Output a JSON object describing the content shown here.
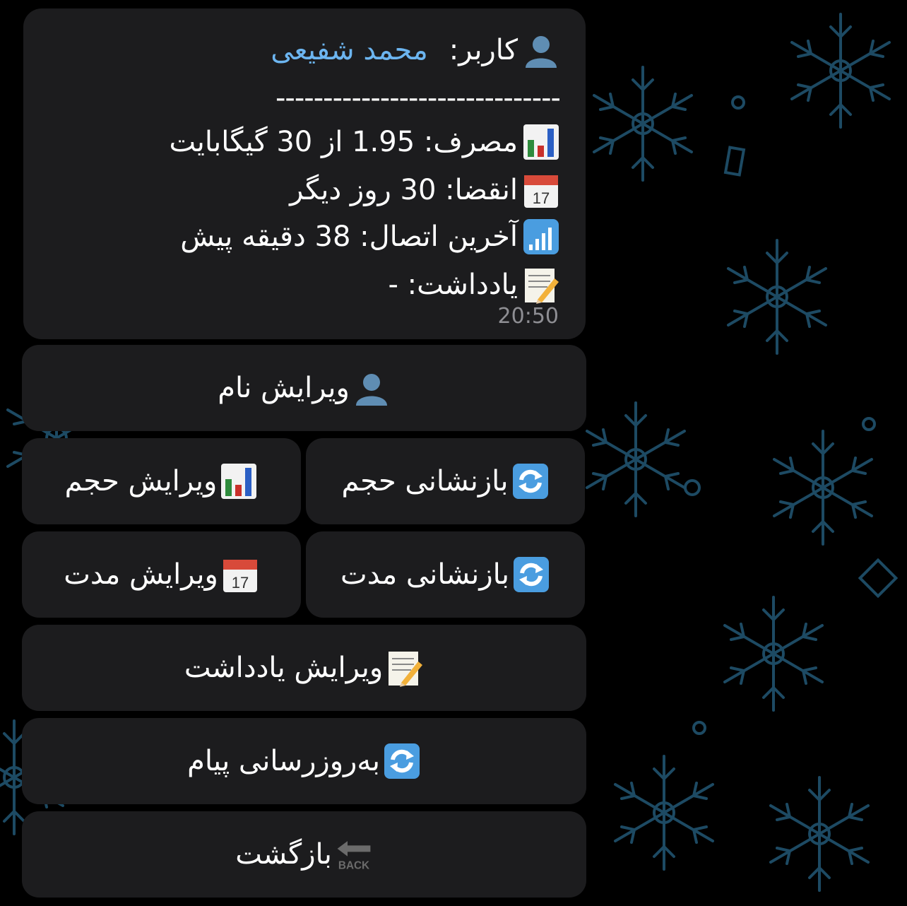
{
  "message": {
    "user_label": "کاربر:",
    "user_name": "محمد شفیعی",
    "separator": "------------------------------",
    "usage": "مصرف: 1.95 از 30 گیگابایت",
    "expiry": "انقضا: 30 روز دیگر",
    "last_connection": "آخرین اتصال: 38 دقیقه پیش",
    "note": "یادداشت: -",
    "time": "20:50",
    "icons": [
      "bust-in-silhouette-icon",
      "bar-chart-icon",
      "calendar-icon",
      "signal-strength-icon",
      "memo-icon"
    ]
  },
  "buttons": {
    "edit_name": "ویرایش نام",
    "edit_size": "ویرایش حجم",
    "reset_size": "بازنشانی حجم",
    "edit_duration": "ویرایش مدت",
    "reset_duration": "بازنشانی مدت",
    "edit_note": "ویرایش یادداشت",
    "refresh_message": "به‌روزرسانی پیام",
    "back": "بازگشت",
    "back_icon_text": "BACK"
  },
  "colors": {
    "background": "#000000",
    "bubble": "#1c1c1e",
    "username": "#6cb5f0",
    "pattern": "#1d4a63",
    "timestamp": "#8e8e93"
  }
}
